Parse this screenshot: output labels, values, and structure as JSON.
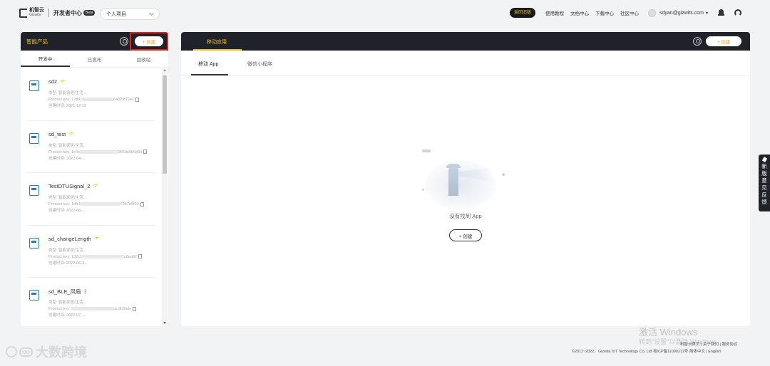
{
  "header": {
    "logo_cn": "机智云",
    "logo_en": "Gizwits",
    "dev_center": "开发者中心",
    "beta": "Beta",
    "project_select": "个人项目",
    "back_old": "返回旧版",
    "nav": [
      "使用教程",
      "文档中心",
      "下载中心",
      "社区中心"
    ],
    "user_email": "sdyan@gizwits.com",
    "user_caret": "▾"
  },
  "left_panel": {
    "title": "智能产品",
    "create_label": "+ 创建",
    "tabs": [
      "开发中",
      "已发布",
      "回收站"
    ],
    "products": [
      {
        "name": "sd2",
        "conn": "wifi",
        "type": "类型: 智能家居/生活...",
        "key_prefix": "Product key: 72891f",
        "key_suffix": "64829f7642",
        "created": "创建时间: 2021-12-10"
      },
      {
        "name": "sd_test",
        "conn": "wifi",
        "type": "类型: 智能家居/生活...",
        "key_prefix": "Product key: 1e4c",
        "key_suffix": "38f3da6b6d03",
        "created": "创建时间: 2022-04-..."
      },
      {
        "name": "TestDTUSignal_2",
        "conn": "wifi",
        "type": "类型: 智能家居/生活...",
        "key_prefix": "Product key: 1dfc5",
        "key_suffix": "73b7e9f69",
        "created": "创建时间: 2022-06-..."
      },
      {
        "name": "sd_changeLength",
        "conn": "wifi",
        "type": "类型: 智能家居/生活...",
        "key_prefix": "Product key: 132c1",
        "key_suffix": "1c8ea82",
        "created": "创建时间: 2022-06-2..."
      },
      {
        "name": "sd_BLE_风扇",
        "conn": "bluetooth",
        "type": "类型: 智能家居/生活...",
        "key_prefix": "Product key: ",
        "key_suffix": "ac9b3bde",
        "created": "创建时间: 2022-07-..."
      }
    ]
  },
  "right_panel": {
    "title": "移动应用",
    "create_label": "+ 创建",
    "tabs": [
      "移动 App",
      "微信小程序"
    ],
    "empty_text": "没有找到 App",
    "empty_create": "+ 创建"
  },
  "feedback": [
    "新",
    "版",
    "意",
    "见",
    "反",
    "馈"
  ],
  "footer": {
    "win_title": "激活 Windows",
    "win_sub": "转到\"设置\"以激活 Windows。",
    "links": "机智云首页 | 关于我们 | 服务协议",
    "copyright": "©2011~2022：Gizwits IoT Technology Co, Ltd 粤ICP备11090211号 简体中文 | English",
    "brand": "大数跨境"
  },
  "colors": {
    "accent": "#f0c419",
    "dark_header": "#1f2329",
    "highlight_red": "#e42222",
    "icon_blue": "#2a7ab8"
  }
}
